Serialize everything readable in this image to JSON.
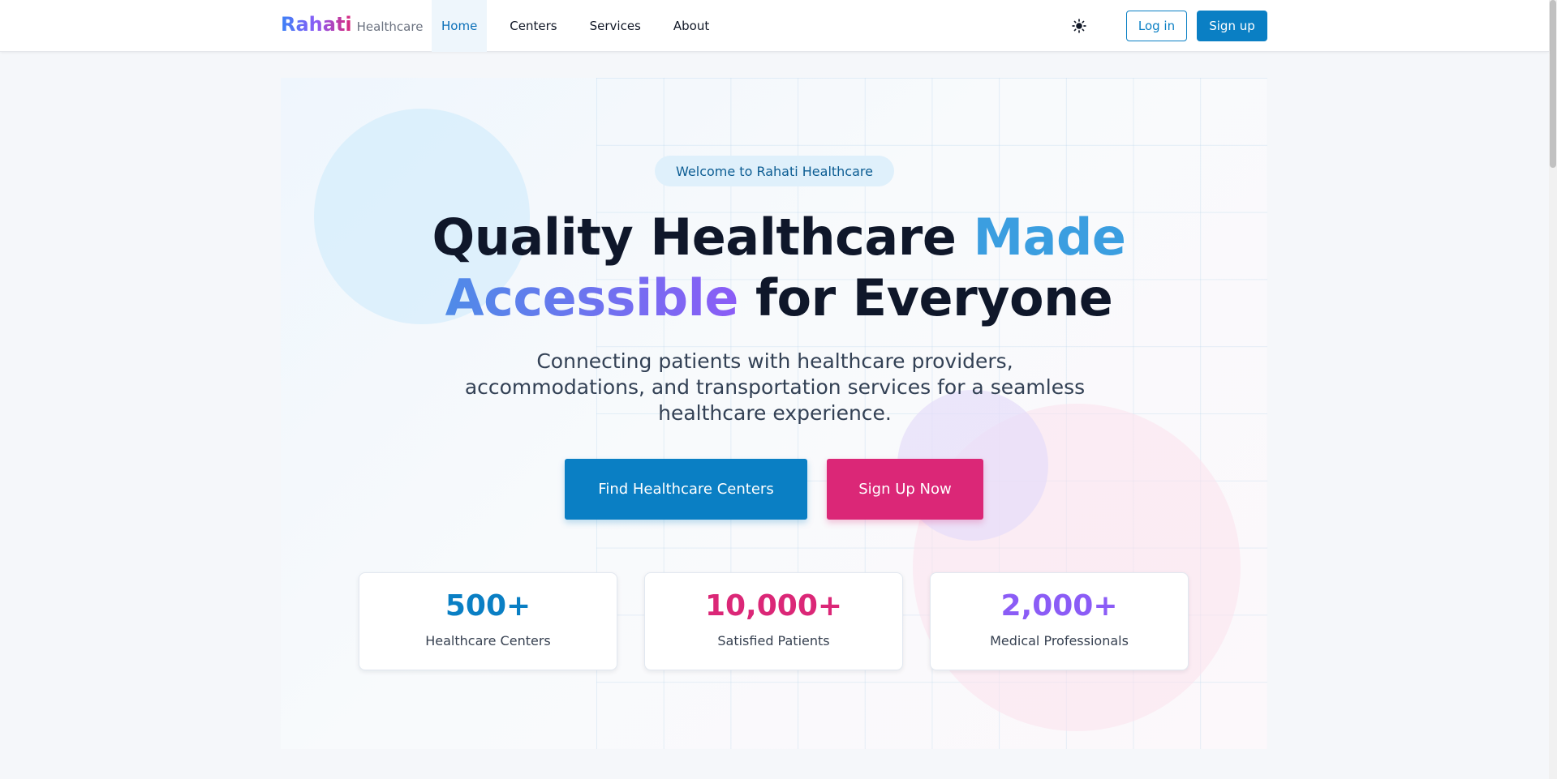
{
  "brand": {
    "name": "Rahati",
    "sub": "Healthcare"
  },
  "nav": {
    "items": [
      {
        "label": "Home"
      },
      {
        "label": "Centers"
      },
      {
        "label": "Services"
      },
      {
        "label": "About"
      }
    ],
    "active": "Home",
    "login_label": "Log in",
    "signup_label": "Sign up",
    "theme_icon": "sun-icon"
  },
  "hero": {
    "pill": "Welcome to Rahati Healthcare",
    "headline_part1": "Quality Healthcare ",
    "headline_highlight1": "Made",
    "headline_highlight2": "Accessible",
    "headline_part2": " for Everyone",
    "subtext": "Connecting patients with healthcare providers, accommodations, and transportation services for a seamless healthcare experience.",
    "primary_button": "Find Healthcare Centers",
    "secondary_button": "Sign Up Now"
  },
  "stats": [
    {
      "value": "500+",
      "label": "Healthcare Centers",
      "color": "#0a7fc4"
    },
    {
      "value": "10,000+",
      "label": "Satisfied Patients",
      "color": "#db2777"
    },
    {
      "value": "2,000+",
      "label": "Medical Professionals",
      "color": "#8b5cf6"
    }
  ],
  "colors": {
    "primary": "#0a7fc4",
    "accent_pink": "#db2777",
    "accent_purple": "#8b5cf6",
    "accent_blue": "#3b9ee0"
  }
}
